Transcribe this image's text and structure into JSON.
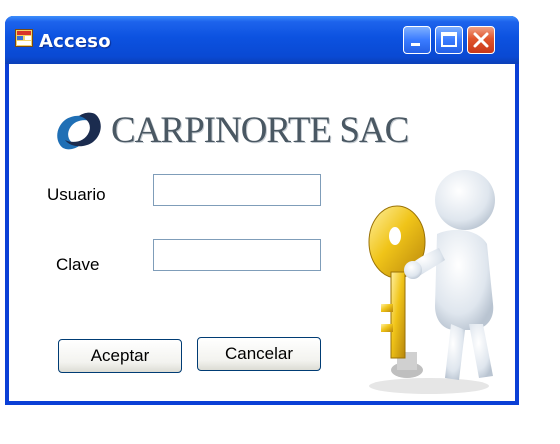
{
  "window": {
    "title": "Acceso"
  },
  "logo": {
    "text": "CARPINORTE SAC"
  },
  "form": {
    "usuario_label": "Usuario",
    "usuario_value": "",
    "clave_label": "Clave",
    "clave_value": "",
    "accept_label": "Aceptar",
    "cancel_label": "Cancelar"
  },
  "colors": {
    "titlebar": "#0a49d3",
    "close_button": "#e0552d",
    "key": "#f0c419",
    "input_border": "#7f9db9"
  }
}
